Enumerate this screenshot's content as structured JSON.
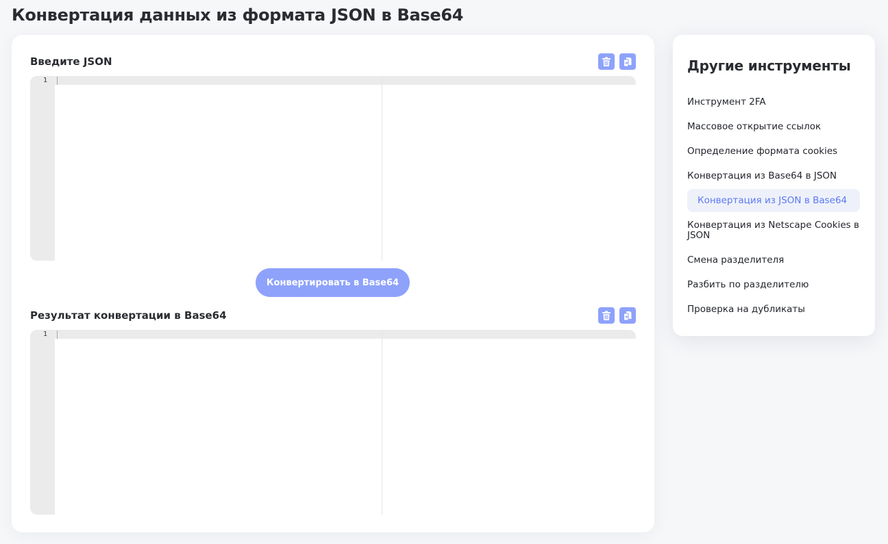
{
  "page": {
    "title": "Конвертация данных из формата JSON в Base64"
  },
  "input_section": {
    "label": "Введите JSON",
    "clear_icon": "trash-icon",
    "paste_icon": "paste-icon",
    "line_number": "1"
  },
  "convert_button": {
    "label": "Конвертировать в Base64"
  },
  "output_section": {
    "label": "Результат конвертации в Base64",
    "clear_icon": "trash-icon",
    "copy_icon": "paste-icon",
    "line_number": "1"
  },
  "sidebar": {
    "title": "Другие инструменты",
    "items": [
      {
        "label": "Инструмент 2FA"
      },
      {
        "label": "Массовое открытие ссылок"
      },
      {
        "label": "Определение формата cookies"
      },
      {
        "label": "Конвертация из Base64 в JSON"
      },
      {
        "label": "Конвертация из JSON в Base64",
        "active": true
      },
      {
        "label": "Конвертация из Netscape Cookies в JSON"
      },
      {
        "label": "Смена разделителя"
      },
      {
        "label": "Разбить по разделителю"
      },
      {
        "label": "Проверка на дубликаты"
      }
    ]
  },
  "colors": {
    "accent": "#8ea2fb",
    "active_text": "#5c79f2",
    "active_bg": "#eef1fa",
    "background": "#f6f7f9"
  }
}
